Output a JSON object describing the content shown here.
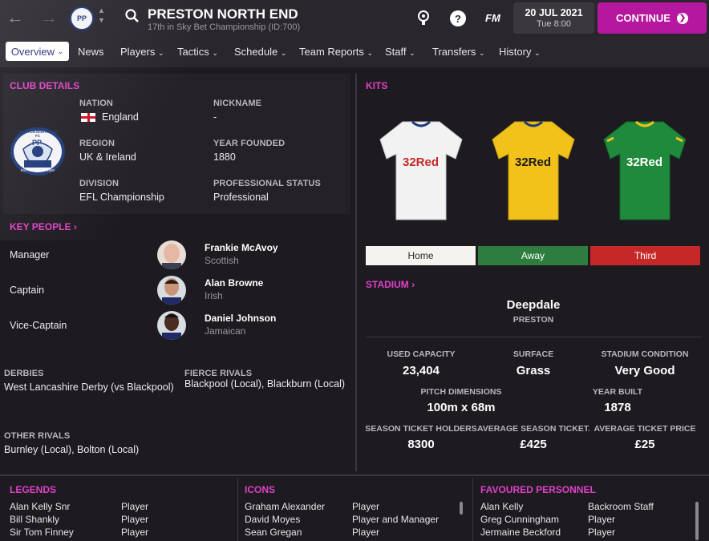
{
  "header": {
    "club_name": "PRESTON NORTH END",
    "club_subtitle": "17th in Sky Bet Championship (ID:700)",
    "crest_text": "PP",
    "date": "20 JUL 2021",
    "time": "Tue 8:00",
    "continue_label": "CONTINUE",
    "fm_label": "FM",
    "help_label": "?"
  },
  "nav": {
    "active": "Overview",
    "items": [
      "News",
      "Players",
      "Tactics",
      "Schedule",
      "Team Reports",
      "Staff",
      "Transfers",
      "History"
    ]
  },
  "club_details": {
    "title": "CLUB DETAILS",
    "crest_top": "PRESTON NORTH END FC",
    "crest_bottom": "ESTABLISHED 1880",
    "crest_letters": "PP",
    "nation_label": "NATION",
    "nation": "England",
    "nickname_label": "NICKNAME",
    "nickname": "-",
    "region_label": "REGION",
    "region": "UK & Ireland",
    "year_label": "YEAR FOUNDED",
    "year": "1880",
    "division_label": "DIVISION",
    "division": "EFL Championship",
    "status_label": "PROFESSIONAL STATUS",
    "status": "Professional"
  },
  "key_people": {
    "title": "KEY PEOPLE",
    "people": [
      {
        "role": "Manager",
        "name": "Frankie McAvoy",
        "nat": "Scottish"
      },
      {
        "role": "Captain",
        "name": "Alan Browne",
        "nat": "Irish"
      },
      {
        "role": "Vice-Captain",
        "name": "Daniel Johnson",
        "nat": "Jamaican"
      }
    ]
  },
  "rivals": {
    "derbies_label": "DERBIES",
    "derbies": "West Lancashire Derby (vs Blackpool)",
    "fierce_label": "FIERCE RIVALS",
    "fierce": "Blackpool (Local), Blackburn (Local)",
    "other_label": "OTHER RIVALS",
    "other": "Burnley (Local), Bolton (Local)"
  },
  "kits": {
    "title": "KITS",
    "sponsor": "32Red",
    "tabs": [
      "Home",
      "Away",
      "Third"
    ]
  },
  "stadium": {
    "title": "STADIUM",
    "name": "Deepdale",
    "city": "PRESTON",
    "used_capacity_label": "USED CAPACITY",
    "used_capacity": "23,404",
    "surface_label": "SURFACE",
    "surface": "Grass",
    "condition_label": "STADIUM CONDITION",
    "condition": "Very Good",
    "pitch_label": "PITCH DIMENSIONS",
    "pitch": "100m x 68m",
    "built_label": "YEAR BUILT",
    "built": "1878",
    "season_holders_label": "SEASON TICKET HOLDERS",
    "season_holders": "8300",
    "avg_season_label": "AVERAGE SEASON TICKET...",
    "avg_season": "£425",
    "avg_ticket_label": "AVERAGE TICKET PRICE",
    "avg_ticket": "£25"
  },
  "legends": {
    "title": "LEGENDS",
    "rows": [
      {
        "name": "Alan Kelly Snr",
        "type": "Player"
      },
      {
        "name": "Bill Shankly",
        "type": "Player"
      },
      {
        "name": "Sir Tom Finney",
        "type": "Player"
      }
    ]
  },
  "icons": {
    "title": "ICONS",
    "rows": [
      {
        "name": "Graham Alexander",
        "type": "Player"
      },
      {
        "name": "David Moyes",
        "type": "Player and Manager"
      },
      {
        "name": "Sean Gregan",
        "type": "Player"
      }
    ]
  },
  "favoured": {
    "title": "FAVOURED PERSONNEL",
    "rows": [
      {
        "name": "Alan Kelly",
        "type": "Backroom Staff"
      },
      {
        "name": "Greg Cunningham",
        "type": "Player"
      },
      {
        "name": "Jermaine Beckford",
        "type": "Player"
      }
    ]
  },
  "colors": {
    "accent": "#e040c8",
    "continue": "#b5179e",
    "kit_home": "#f4f3ee",
    "kit_away": "#2e7d3e",
    "kit_third": "#c62828"
  }
}
